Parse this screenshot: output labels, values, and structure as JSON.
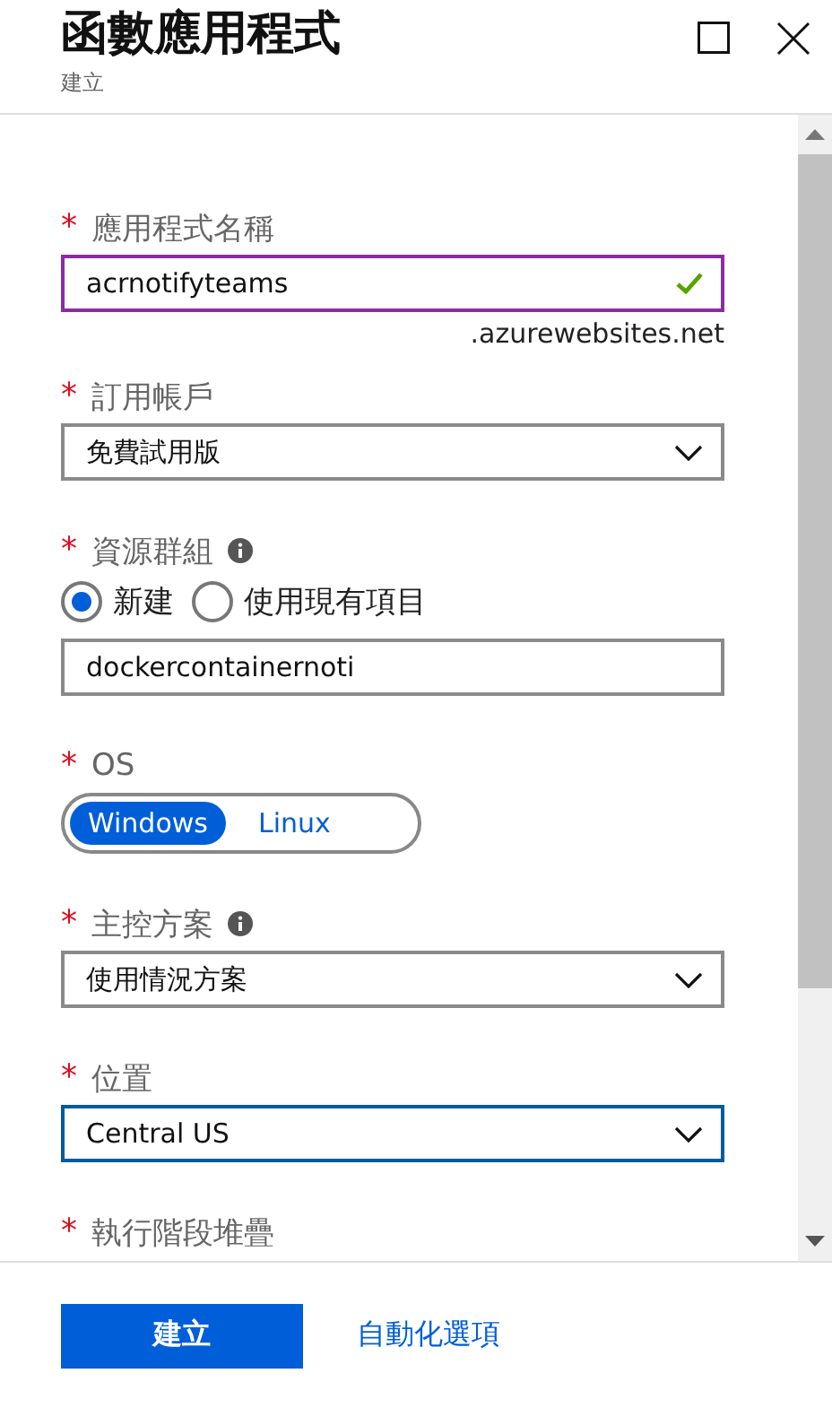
{
  "window": {
    "title": "函數應用程式",
    "subtitle": "建立"
  },
  "fields": [
    {
      "kind": "text",
      "marker": "*",
      "label": "應用程式名稱",
      "value": "acrnotifyteams",
      "valid": true,
      "focused": true,
      "suffix": ".azurewebsites.net"
    },
    {
      "kind": "select",
      "marker": "*",
      "label": "訂用帳戶",
      "value": "免費試用版",
      "focused": false
    },
    {
      "kind": "radio-text",
      "marker": "*",
      "label": "資源群組",
      "info": true,
      "options": [
        {
          "label": "新建",
          "selected": true
        },
        {
          "label": "使用現有項目",
          "selected": false
        }
      ],
      "value": "dockercontainernoti"
    },
    {
      "kind": "toggle",
      "marker": "*",
      "label": "OS",
      "options": [
        {
          "label": "Windows",
          "selected": true
        },
        {
          "label": "Linux",
          "selected": false
        }
      ]
    },
    {
      "kind": "select",
      "marker": "*",
      "label": "主控方案",
      "info": true,
      "value": "使用情況方案",
      "focused": false
    },
    {
      "kind": "select",
      "marker": "*",
      "label": "位置",
      "value": "Central US",
      "focused": true
    },
    {
      "kind": "label",
      "marker": "*",
      "label": "執行階段堆疊"
    }
  ],
  "footer": {
    "primary": "建立",
    "link": "自動化選項"
  }
}
